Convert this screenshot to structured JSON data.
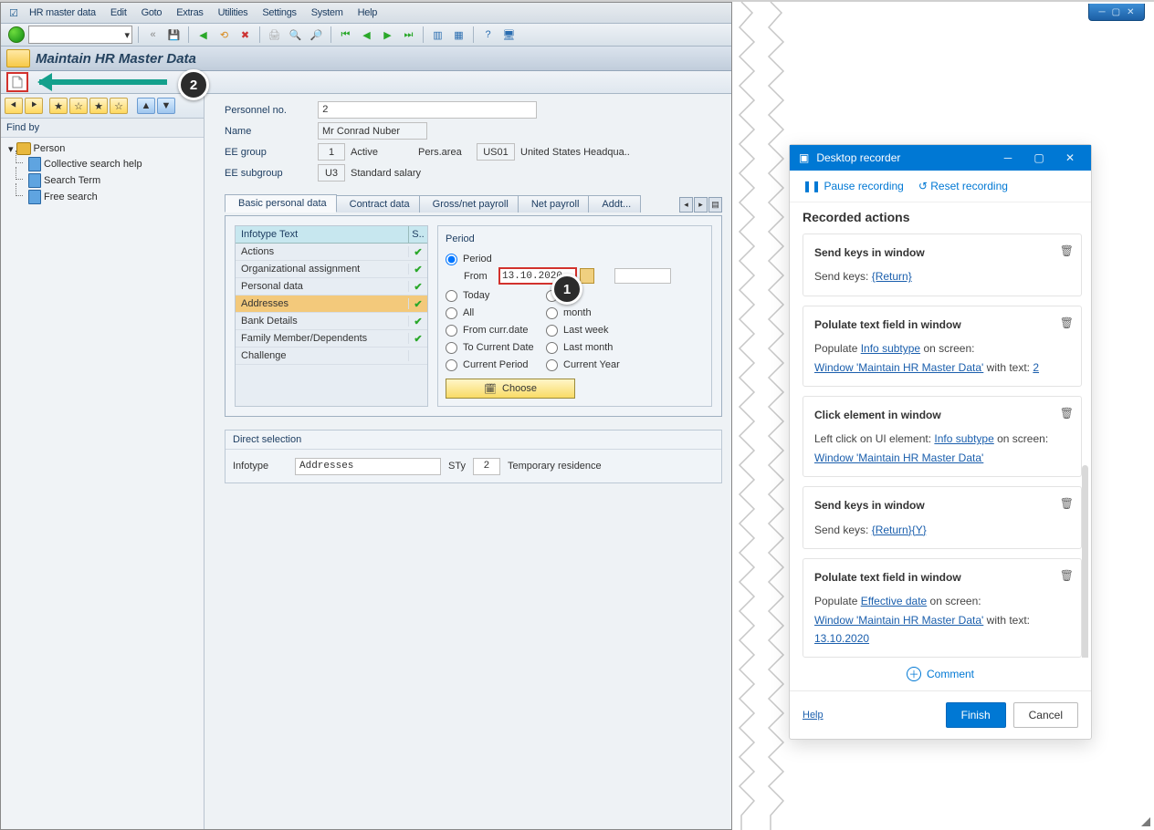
{
  "menubar": [
    "HR master data",
    "Edit",
    "Goto",
    "Extras",
    "Utilities",
    "Settings",
    "System",
    "Help"
  ],
  "page_title": "Maintain HR Master Data",
  "header_fields": {
    "personnel_lbl": "Personnel no.",
    "personnel_val": "2",
    "name_lbl": "Name",
    "name_val": "Mr Conrad Nuber",
    "eeg_lbl": "EE group",
    "eeg_code": "1",
    "eeg_txt": "Active",
    "persarea_lbl": "Pers.area",
    "persarea_code": "US01",
    "persarea_txt": "United States Headqua..",
    "eesg_lbl": "EE subgroup",
    "eesg_code": "U3",
    "eesg_txt": "Standard salary"
  },
  "nav": {
    "find": "Find by",
    "root": "Person",
    "items": [
      "Collective search help",
      "Search Term",
      "Free search"
    ]
  },
  "tabs": [
    "Basic personal data",
    "Contract data",
    "Gross/net payroll",
    "Net payroll",
    "Addt..."
  ],
  "infotype": {
    "head_text": "Infotype Text",
    "head_s": "S..",
    "rows": [
      {
        "t": "Actions",
        "ck": true
      },
      {
        "t": "Organizational assignment",
        "ck": true
      },
      {
        "t": "Personal data",
        "ck": true
      },
      {
        "t": "Addresses",
        "ck": true,
        "sel": true
      },
      {
        "t": "Bank Details",
        "ck": true
      },
      {
        "t": "Family Member/Dependents",
        "ck": true
      },
      {
        "t": "Challenge",
        "ck": false
      }
    ]
  },
  "period": {
    "title": "Period",
    "radio_period": "Period",
    "from_lbl": "From",
    "from_val": "13.10.2020",
    "opts_left": [
      "Today",
      "All",
      "From curr.date",
      "To Current Date",
      "Current Period"
    ],
    "opts_right": [
      "ek",
      "month",
      "Last week",
      "Last month",
      "Current Year"
    ],
    "choose": "Choose"
  },
  "direct": {
    "title": "Direct selection",
    "inf_lbl": "Infotype",
    "inf_val": "Addresses",
    "sty_lbl": "STy",
    "sty_val": "2",
    "sty_txt": "Temporary residence"
  },
  "recorder": {
    "title": "Desktop recorder",
    "pause": "Pause recording",
    "reset": "Reset recording",
    "section": "Recorded actions",
    "cards": [
      {
        "t": "Send keys in window",
        "b": [
          [
            "Send keys: ",
            {
              "lnk": "{Return}"
            }
          ]
        ]
      },
      {
        "t": "Polulate text field in window",
        "b": [
          [
            "Populate ",
            {
              "lnk": "Info subtype"
            },
            " on screen:"
          ],
          [
            {
              "lnk": "Window 'Maintain HR Master Data'"
            },
            " with text: ",
            {
              "lnk": "2"
            }
          ]
        ]
      },
      {
        "t": "Click element in window",
        "b": [
          [
            "Left click on UI element: ",
            {
              "lnk": "Info subtype"
            },
            " on screen:"
          ],
          [
            {
              "lnk": "Window 'Maintain HR Master Data'"
            }
          ]
        ]
      },
      {
        "t": "Send keys in window",
        "b": [
          [
            "Send keys: ",
            {
              "lnk": "{Return}{Y}"
            }
          ]
        ]
      },
      {
        "t": "Polulate text field in window",
        "b": [
          [
            "Populate ",
            {
              "lnk": "Effective date"
            },
            " on screen:"
          ],
          [
            {
              "lnk": "Window 'Maintain HR Master Data'"
            },
            " with text: ",
            {
              "lnk": "13.10.2020"
            }
          ]
        ]
      }
    ],
    "comment": "Comment",
    "help": "Help",
    "finish": "Finish",
    "cancel": "Cancel"
  },
  "badges": {
    "one": "1",
    "two": "2"
  }
}
